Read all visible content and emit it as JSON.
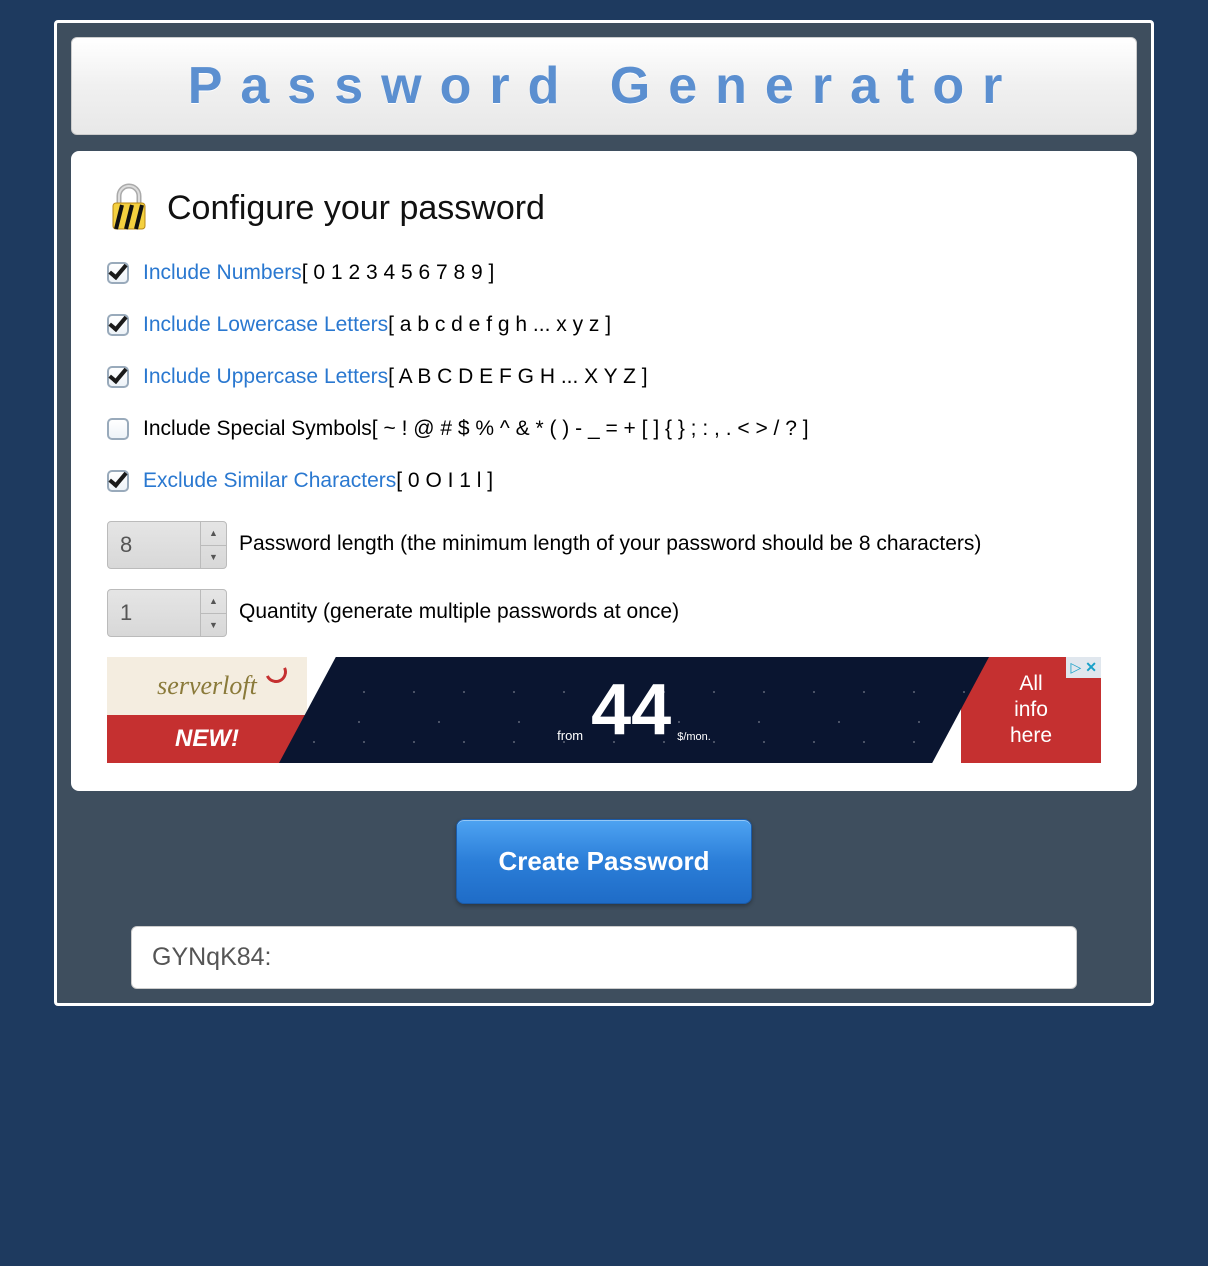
{
  "title": "Password Generator",
  "configHeading": "Configure your password",
  "options": [
    {
      "checked": true,
      "link": "Include Numbers",
      "desc": "[ 0 1 2 3 4 5 6 7 8 9 ]"
    },
    {
      "checked": true,
      "link": "Include Lowercase Letters",
      "desc": "[ a b c d e f g h ... x y z ]"
    },
    {
      "checked": true,
      "link": "Include Uppercase Letters",
      "desc": "[ A B C D E F G H ... X Y Z ]"
    },
    {
      "checked": false,
      "link": "Include Special Symbols",
      "desc": "[ ~ ! @ # $ % ^ & * ( ) - _ = + [ ] { } ; : , . < > / ? ]"
    },
    {
      "checked": true,
      "link": "Exclude Similar Characters",
      "desc": "[ 0 O I 1 l ]"
    }
  ],
  "lengthValue": "8",
  "lengthLabel": "Password length (the minimum length of your password should be 8 characters)",
  "quantityValue": "1",
  "quantityLabel": "Quantity (generate multiple passwords at once)",
  "ad": {
    "brand": "serverloft",
    "newLabel": "NEW!",
    "from": "from",
    "price": "44",
    "unit": "$/mon.",
    "rightLine1": "All",
    "rightLine2": "info",
    "rightLine3": "here"
  },
  "createButton": "Create Password",
  "generatedPassword": "GYNqK84:"
}
